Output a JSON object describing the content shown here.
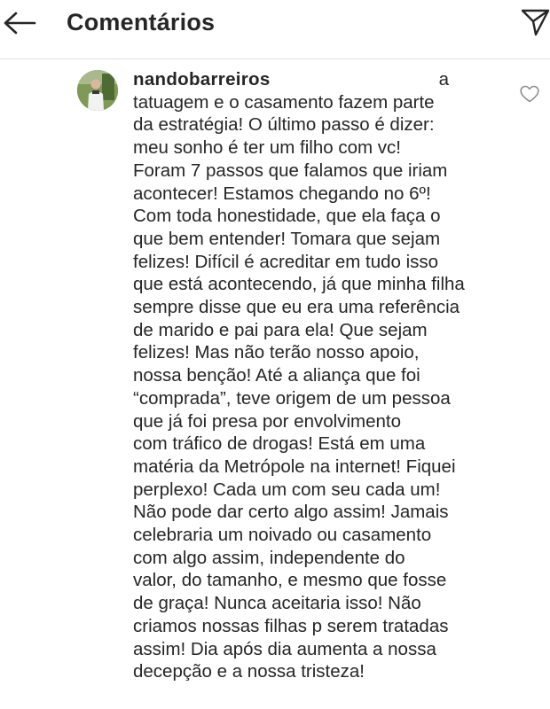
{
  "header": {
    "title": "Comentários",
    "back_icon": "arrow-left-icon",
    "send_icon": "paper-plane-icon"
  },
  "comment": {
    "username": "nandobarreiros",
    "like_icon": "heart-outline-icon",
    "lines": [
      "a",
      "tatuagem e o casamento fazem parte",
      "da estratégia! O último passo é dizer:",
      "meu sonho é ter um filho com vc!",
      "Foram 7 passos que falamos que iriam",
      "acontecer! Estamos chegando no 6º!",
      "Com toda honestidade, que ela faça o",
      "que bem entender! Tomara que sejam",
      "felizes! Difícil é acreditar em tudo isso",
      "que está acontecendo, já que minha filha",
      "sempre disse que eu era uma referência",
      "de marido e pai para ela! Que sejam",
      "felizes! Mas não terão nosso apoio,",
      "nossa benção! Até a aliança que foi",
      "“comprada”, teve origem de um pessoa",
      "que já foi presa por envolvimento",
      "com tráfico de drogas! Está em uma",
      "matéria da Metrópole na internet! Fiquei",
      "perplexo! Cada um com seu cada um!",
      "Não pode dar certo algo assim! Jamais",
      "celebraria um noivado ou casamento",
      "com algo assim, independente do",
      "valor, do tamanho, e mesmo que fosse",
      "de graça! Nunca aceitaria isso! Não",
      "criamos nossas filhas p serem tratadas",
      "assim! Dia após dia aumenta a nossa",
      "decepção e a nossa tristeza!"
    ]
  },
  "colors": {
    "text": "#262626",
    "divider": "#e0e0e0",
    "background": "#ffffff"
  }
}
